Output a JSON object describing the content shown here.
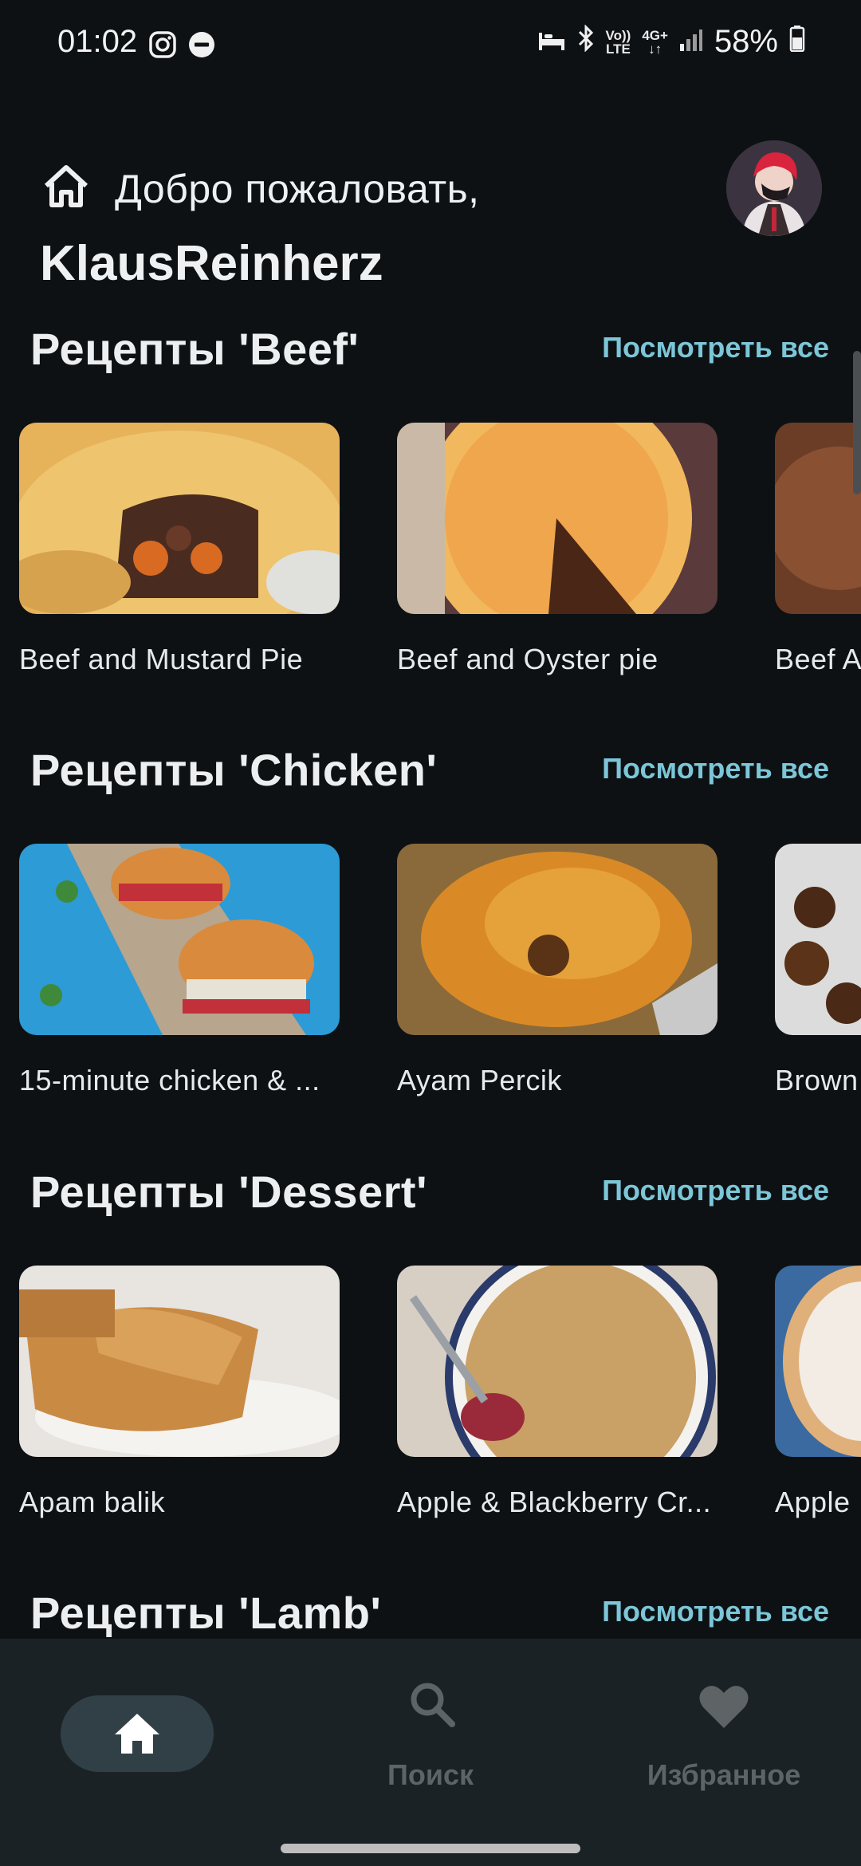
{
  "status": {
    "time": "01:02",
    "battery": "58%",
    "volte_top": "Vo))",
    "volte_bottom": "LTE",
    "net_top": "4G+",
    "net_bottom": "↓↑"
  },
  "header": {
    "greeting": "Добро пожаловать,",
    "username": "KlausReinherz"
  },
  "sections": [
    {
      "title": "Рецепты 'Beef'",
      "link": "Посмотреть все",
      "cards": [
        "Beef and Mustard Pie",
        "Beef and Oyster pie",
        "Beef A"
      ]
    },
    {
      "title": "Рецепты 'Chicken'",
      "link": "Посмотреть все",
      "cards": [
        "15-minute chicken & ...",
        "Ayam Percik",
        "Brown"
      ]
    },
    {
      "title": "Рецепты 'Dessert'",
      "link": "Посмотреть все",
      "cards": [
        "Apam balik",
        "Apple & Blackberry Cr...",
        "Apple"
      ]
    },
    {
      "title": "Рецепты 'Lamb'",
      "link": "Посмотреть все"
    }
  ],
  "nav": {
    "search": "Поиск",
    "favorites": "Избранное"
  },
  "colors": {
    "background": "#0d1114",
    "accent_link": "#7cc6d7",
    "nav_bar": "#1b2226",
    "nav_active_pill": "#304046",
    "nav_inactive": "#5e6366"
  }
}
